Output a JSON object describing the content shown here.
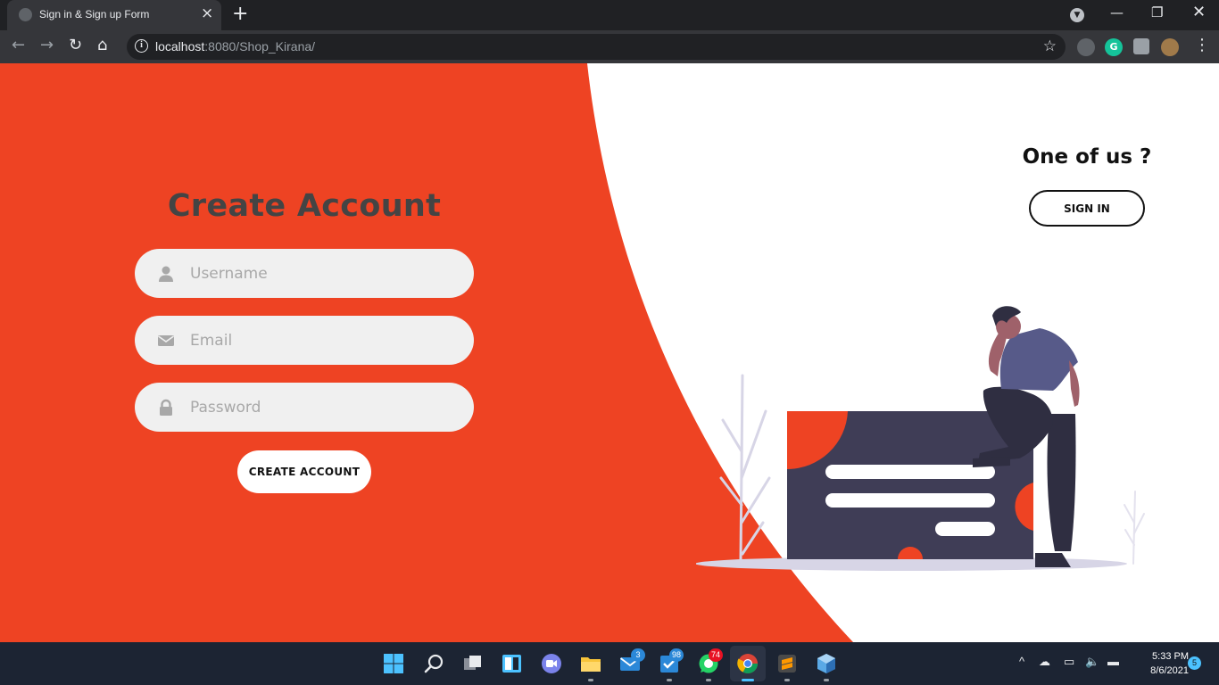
{
  "browser": {
    "tab_title": "Sign in & Sign up Form",
    "url_host": "localhost",
    "url_rest": ":8080/Shop_Kirana/",
    "icons": {
      "tab_close": "close-icon",
      "new_tab": "plus-icon",
      "back": "arrow-left-icon",
      "forward": "arrow-right-icon",
      "reload": "reload-icon",
      "home": "home-icon",
      "bookmark": "star-icon"
    }
  },
  "form": {
    "title": "Create Account",
    "username_placeholder": "Username",
    "email_placeholder": "Email",
    "password_placeholder": "Password",
    "submit_label": "CREATE ACCOUNT"
  },
  "panel": {
    "title": "One of us ?",
    "signin_label": "SIGN IN"
  },
  "taskbar": {
    "badges": {
      "mail": "3",
      "todo": "98",
      "whatsapp": "74"
    },
    "time": "5:33 PM",
    "date": "8/6/2021",
    "notifications": "5"
  },
  "colors": {
    "accent": "#ee4323",
    "dark_card": "#3f3d56",
    "chrome_bg": "#202124",
    "toolbar_bg": "#35363a",
    "taskbar_bg": "#1c2433"
  }
}
